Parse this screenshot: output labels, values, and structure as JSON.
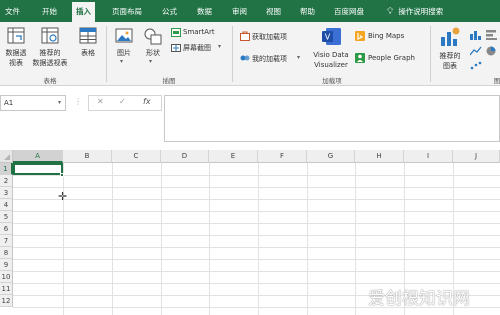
{
  "menu": {
    "tabs": [
      "文件",
      "开始",
      "插入",
      "页面布局",
      "公式",
      "数据",
      "审阅",
      "视图",
      "帮助",
      "百度网盘"
    ],
    "active_tab": "插入",
    "tell_me": "操作说明搜索"
  },
  "ribbon": {
    "tables": {
      "pivot_table": [
        "数据透",
        "视表"
      ],
      "recommended_pivot": [
        "推荐的",
        "数据透视表"
      ],
      "table": "表格",
      "group_label": "表格"
    },
    "illustrations": {
      "pictures": "图片",
      "shapes": "形状",
      "smartart": "SmartArt",
      "screenshot": "屏幕截图",
      "group_label": "插图"
    },
    "addins": {
      "get_addins": "获取加载项",
      "my_addins": "我的加载项",
      "visio": [
        "Visio Data",
        "Visualizer"
      ],
      "bing_maps": "Bing Maps",
      "people_graph": "People Graph",
      "group_label": "加载项"
    },
    "charts": {
      "recommended_charts": [
        "推荐的",
        "图表"
      ],
      "group_label": "图"
    }
  },
  "formula_bar": {
    "name_box": "A1",
    "cancel_symbol": "✕",
    "enter_symbol": "✓",
    "fx_symbol": "fx",
    "value": ""
  },
  "sheet": {
    "columns": [
      "A",
      "B",
      "C",
      "D",
      "E",
      "F",
      "G",
      "H",
      "I",
      "J"
    ],
    "rows": [
      "1",
      "2",
      "3",
      "4",
      "5",
      "6",
      "7",
      "8",
      "9",
      "10",
      "11",
      "12"
    ],
    "active_cell": "A1"
  },
  "watermark": "爱创根知识网",
  "colors": {
    "excel_green": "#217346",
    "ribbon_bg": "#f3f3f3"
  }
}
